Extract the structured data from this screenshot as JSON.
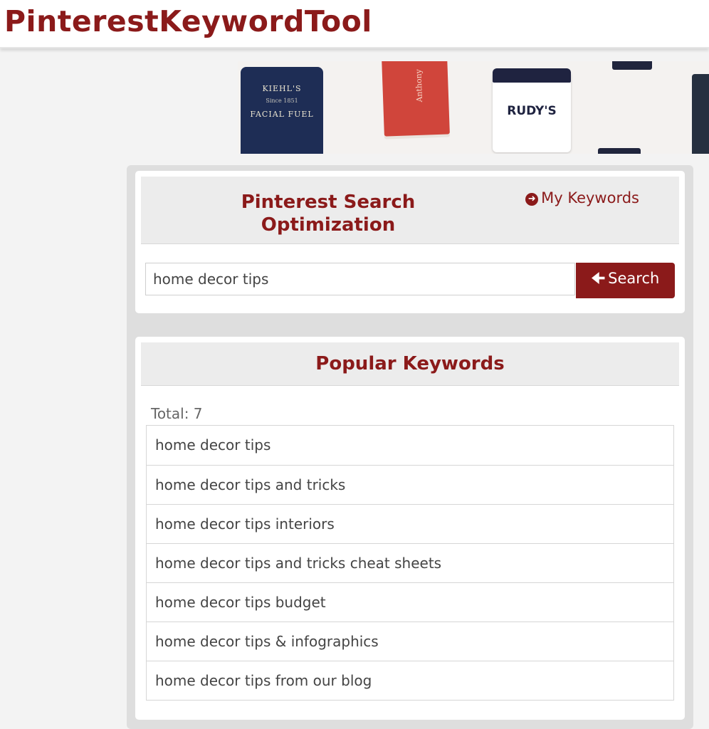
{
  "site": {
    "logo": "PinterestKeywordTool"
  },
  "banner": {
    "product_1_brand": "KIEHL'S",
    "product_1_sub": "Since 1851",
    "product_1_name": "FACIAL FUEL",
    "product_2_brand": "Anthony",
    "product_3_brand": "RUDY'S"
  },
  "search_panel": {
    "title": "Pinterest Search Optimization",
    "my_keywords_label": "My Keywords",
    "search_value": "home decor tips",
    "search_button_label": "Search"
  },
  "popular_panel": {
    "title": "Popular Keywords",
    "total_label": "Total: 7",
    "keywords": [
      "home decor tips",
      "home decor tips and tricks",
      "home decor tips interiors",
      "home decor tips and tricks cheat sheets",
      "home decor tips budget",
      "home decor tips & infographics",
      "home decor tips from our blog"
    ]
  },
  "colors": {
    "accent": "#8b1a1a",
    "panel_header": "#ececec",
    "container": "#dedede"
  }
}
